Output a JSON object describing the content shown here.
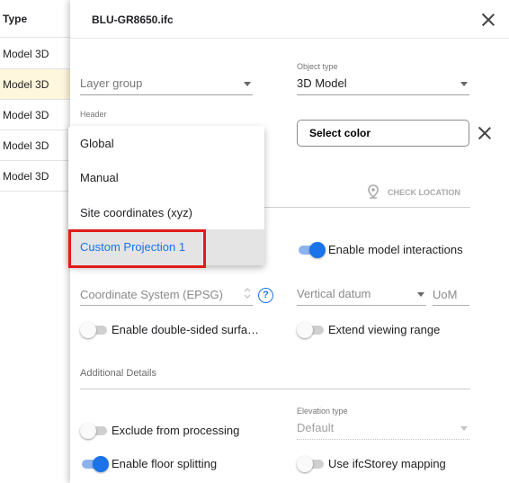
{
  "table": {
    "column_header": "Type",
    "rows": [
      {
        "label": "Model 3D"
      },
      {
        "label": "Model 3D"
      },
      {
        "label": "Model 3D"
      },
      {
        "label": "Model 3D"
      },
      {
        "label": "Model 3D"
      }
    ]
  },
  "panel": {
    "title": "BLU-GR8650.ifc",
    "layer_group": {
      "placeholder": "Layer group"
    },
    "object_type": {
      "label": "Object type",
      "value": "3D Model"
    },
    "header_label": "Header",
    "select_color_label": "Select color",
    "check_location_label": "CHECK LOCATION",
    "enable_model_interactions": {
      "label": "Enable model interactions",
      "on": true
    },
    "coordinate_system": {
      "placeholder": "Coordinate System (EPSG)"
    },
    "vertical_datum": {
      "placeholder": "Vertical datum"
    },
    "uom": {
      "placeholder": "UoM"
    },
    "double_sided": {
      "label": "Enable double-sided surfa…",
      "on": false
    },
    "extend_viewing_range": {
      "label": "Extend viewing range",
      "on": false
    },
    "additional_details_title": "Additional Details",
    "exclude_from_processing": {
      "label": "Exclude from processing",
      "on": false
    },
    "elevation_type": {
      "label": "Elevation type",
      "value": "Default"
    },
    "enable_floor_splitting": {
      "label": "Enable floor splitting",
      "on": true
    },
    "use_ifcstorey_mapping": {
      "label": "Use ifcStorey mapping",
      "on": false
    }
  },
  "dropdown_menu": {
    "items": [
      {
        "label": "Global"
      },
      {
        "label": "Manual"
      },
      {
        "label": "Site coordinates (xyz)"
      },
      {
        "label": "Custom Projection 1",
        "selected": true
      }
    ]
  },
  "colors": {
    "accent": "#1a73e8",
    "selected_row": "#fef6dd",
    "highlight_box": "#e01b1b"
  }
}
